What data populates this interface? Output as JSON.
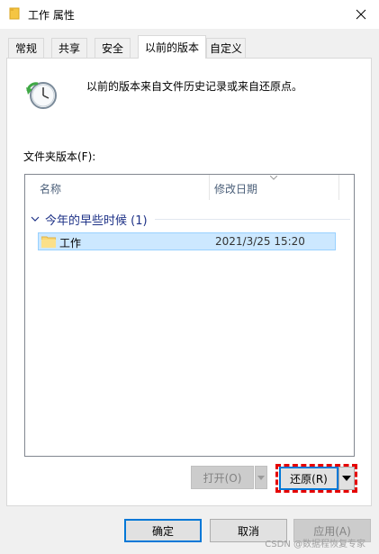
{
  "window": {
    "title": "工作 属性",
    "close_label": "×"
  },
  "tabs": [
    {
      "label": "常规"
    },
    {
      "label": "共享"
    },
    {
      "label": "安全"
    },
    {
      "label": "以前的版本"
    },
    {
      "label": "自定义"
    }
  ],
  "panel": {
    "info_text": "以前的版本来自文件历史记录或来自还原点。",
    "folder_versions_label": "文件夹版本(F):",
    "columns": {
      "name": "名称",
      "date_modified": "修改日期"
    },
    "group": {
      "label": "今年的早些时候 (1)"
    },
    "rows": [
      {
        "name": "工作",
        "date": "2021/3/25 15:20",
        "selected": true
      }
    ]
  },
  "panel_buttons": {
    "open_label": "打开(O)",
    "restore_label": "还原(R)"
  },
  "dialog_buttons": {
    "ok_label": "确定",
    "cancel_label": "取消",
    "apply_label": "应用(A)"
  },
  "watermark": "CSDN @数据程恢复专家",
  "colors": {
    "accent": "#0078d7",
    "selection": "#cce8ff",
    "highlight_dash": "#e50000",
    "group_header": "#1e3287"
  }
}
